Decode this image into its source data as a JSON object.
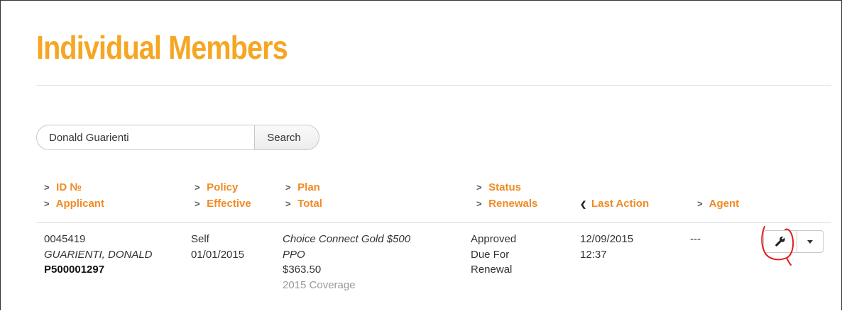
{
  "page": {
    "title": "Individual Members"
  },
  "search": {
    "value": "Donald Guarienti",
    "button_label": "Search"
  },
  "columns": {
    "id": "ID №",
    "applicant": "Applicant",
    "policy": "Policy",
    "effective": "Effective",
    "plan": "Plan",
    "total": "Total",
    "status": "Status",
    "renewals": "Renewals",
    "last_action": "Last Action",
    "agent": "Agent"
  },
  "row": {
    "id": "0045419",
    "applicant": "GUARIENTI, DONALD",
    "member_code": "P500001297",
    "policy": "Self",
    "effective": "01/01/2015",
    "plan_line1": "Choice Connect Gold $500",
    "plan_line2": "PPO",
    "total": "$363.50",
    "coverage": "2015 Coverage",
    "status": "Approved",
    "renewal_line1": "Due For",
    "renewal_line2": "Renewal",
    "last_action_date": "12/09/2015",
    "last_action_time": "12:37",
    "agent": "---"
  },
  "icons": {
    "sort": "chevron-right-icon",
    "sort_active": "chevron-down-icon",
    "tool": "wrench-icon",
    "menu": "caret-down-icon"
  },
  "colors": {
    "title": "#f5a623",
    "header": "#f08a24",
    "annotation": "#e02020"
  }
}
